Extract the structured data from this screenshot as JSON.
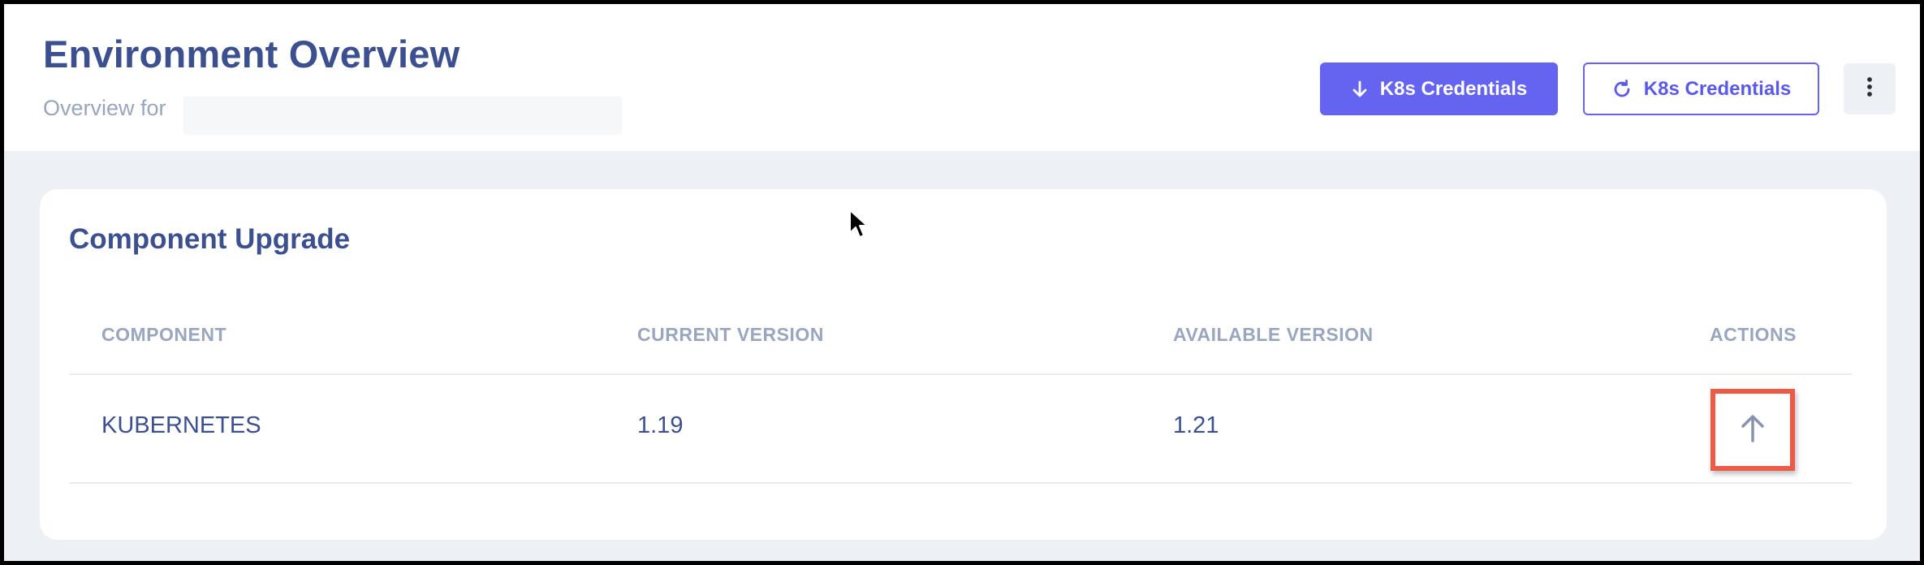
{
  "header": {
    "title": "Environment Overview",
    "subtitle": "Overview for",
    "buttons": {
      "download_label": "K8s Credentials",
      "refresh_label": "K8s Credentials"
    }
  },
  "icons": {
    "download": "download-arrow-icon",
    "refresh": "refresh-icon",
    "more": "more-vertical-icon",
    "upgrade": "arrow-up-icon"
  },
  "colors": {
    "primary": "#6464f0",
    "title_text": "#3c4f8f",
    "muted_text": "#9aa6bd",
    "highlight": "#ee5a48",
    "background": "#edf0f5"
  },
  "card": {
    "title": "Component Upgrade",
    "columns": [
      "COMPONENT",
      "CURRENT VERSION",
      "AVAILABLE VERSION",
      "ACTIONS"
    ],
    "rows": [
      {
        "component": "KUBERNETES",
        "current_version": "1.19",
        "available_version": "1.21"
      }
    ]
  }
}
